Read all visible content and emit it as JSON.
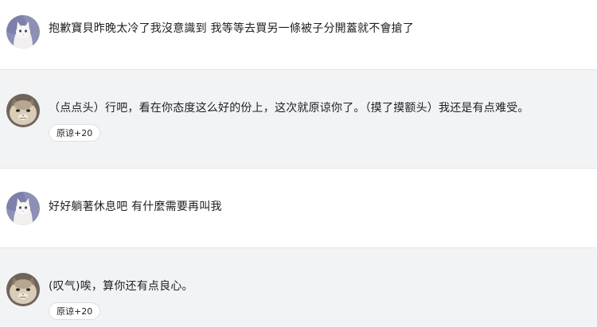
{
  "messages": [
    {
      "role": "user",
      "avatar_icon": "white-cat-avatar-icon",
      "text": "抱歉寶貝昨晚太冷了我沒意識到 我等等去買另一條被子分開蓋就不會搶了"
    },
    {
      "role": "character",
      "avatar_icon": "grumpy-cat-avatar-icon",
      "text": "（点点头）行吧，看在你态度这么好的份上，这次就原谅你了。（摸了摸额头）我还是有点难受。",
      "badge": "原谅+20"
    },
    {
      "role": "user",
      "avatar_icon": "white-cat-avatar-icon",
      "text": "好好躺著休息吧 有什麼需要再叫我"
    },
    {
      "role": "character",
      "avatar_icon": "grumpy-cat-avatar-icon",
      "text": "(叹气)唉，算你还有点良心。",
      "badge": "原谅+20"
    }
  ],
  "colors": {
    "user_bg": "#ffffff",
    "character_bg": "#f2f3f5",
    "divider": "#e4e6ea",
    "text": "#1f1f1f"
  }
}
